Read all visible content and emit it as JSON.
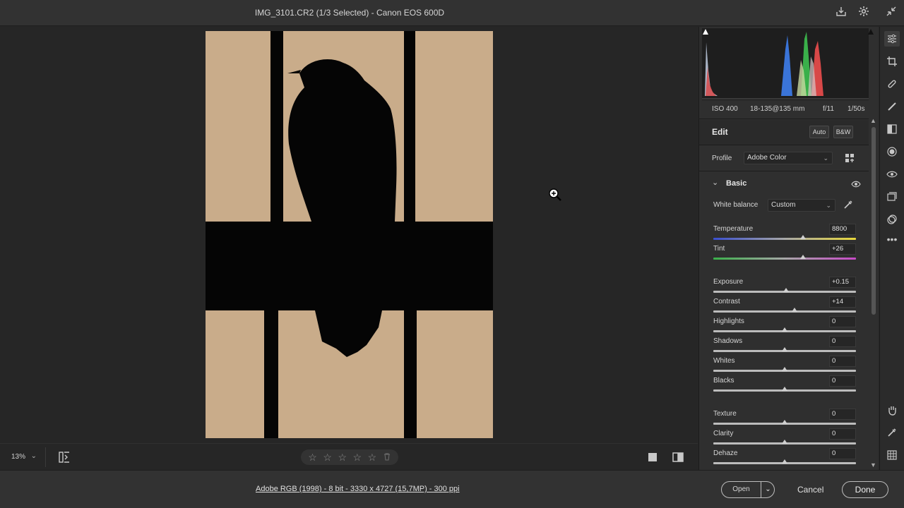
{
  "app": {
    "title": "IMG_3101.CR2 (1/3 Selected)  -  Canon EOS 600D"
  },
  "canvas": {
    "zoom_level": "13%",
    "stars": [
      "☆",
      "☆",
      "☆",
      "☆",
      "☆"
    ]
  },
  "histogram_info": {
    "iso": "ISO 400",
    "lens": "18-135@135 mm",
    "aperture": "f/11",
    "shutter": "1/50s"
  },
  "edit": {
    "title": "Edit",
    "auto_label": "Auto",
    "bw_label": "B&W",
    "profile_label": "Profile",
    "profile_value": "Adobe Color"
  },
  "basic": {
    "title": "Basic",
    "white_balance_label": "White balance",
    "white_balance_value": "Custom",
    "sliders": [
      {
        "label": "Temperature",
        "value": "8800",
        "position": 0.63
      },
      {
        "label": "Tint",
        "value": "+26",
        "position": 0.63
      },
      {
        "label": "Exposure",
        "value": "+0.15",
        "position": 0.51
      },
      {
        "label": "Contrast",
        "value": "+14",
        "position": 0.57
      },
      {
        "label": "Highlights",
        "value": "0",
        "position": 0.5
      },
      {
        "label": "Shadows",
        "value": "0",
        "position": 0.5
      },
      {
        "label": "Whites",
        "value": "0",
        "position": 0.5
      },
      {
        "label": "Blacks",
        "value": "0",
        "position": 0.5
      },
      {
        "label": "Texture",
        "value": "0",
        "position": 0.5
      },
      {
        "label": "Clarity",
        "value": "0",
        "position": 0.5
      },
      {
        "label": "Dehaze",
        "value": "0",
        "position": 0.5
      }
    ]
  },
  "footer": {
    "file_info": "Adobe RGB (1998) - 8 bit - 3330 x 4727 (15,7MP) - 300 ppi",
    "open_label": "Open",
    "cancel_label": "Cancel",
    "done_label": "Done"
  }
}
